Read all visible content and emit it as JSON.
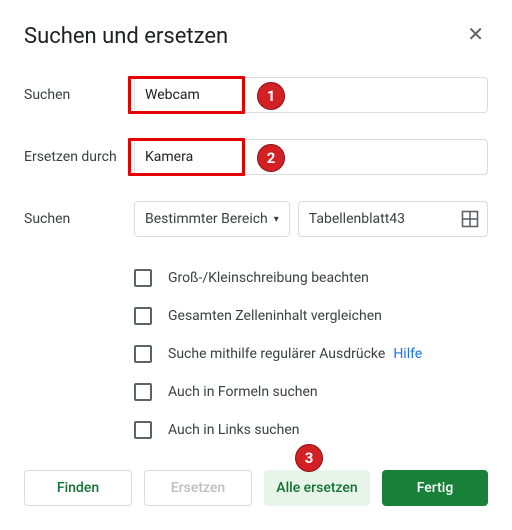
{
  "dialog": {
    "title": "Suchen und ersetzen"
  },
  "labels": {
    "search": "Suchen",
    "replace": "Ersetzen durch",
    "scope": "Suchen"
  },
  "fields": {
    "search_value": "Webcam",
    "replace_value": "Kamera"
  },
  "scope": {
    "dropdown_label": "Bestimmter Bereich",
    "range_value": "Tabellenblatt43"
  },
  "checkboxes": {
    "match_case": "Groß-/Kleinschreibung beachten",
    "entire_cell": "Gesamten Zelleninhalt vergleichen",
    "regex": "Suche mithilfe regulärer Ausdrücke",
    "regex_help": "Hilfe",
    "formulas": "Auch in Formeln suchen",
    "links": "Auch in Links suchen"
  },
  "buttons": {
    "find": "Finden",
    "replace": "Ersetzen",
    "replace_all": "Alle ersetzen",
    "done": "Fertig"
  },
  "annotations": {
    "b1": "1",
    "b2": "2",
    "b3": "3"
  }
}
